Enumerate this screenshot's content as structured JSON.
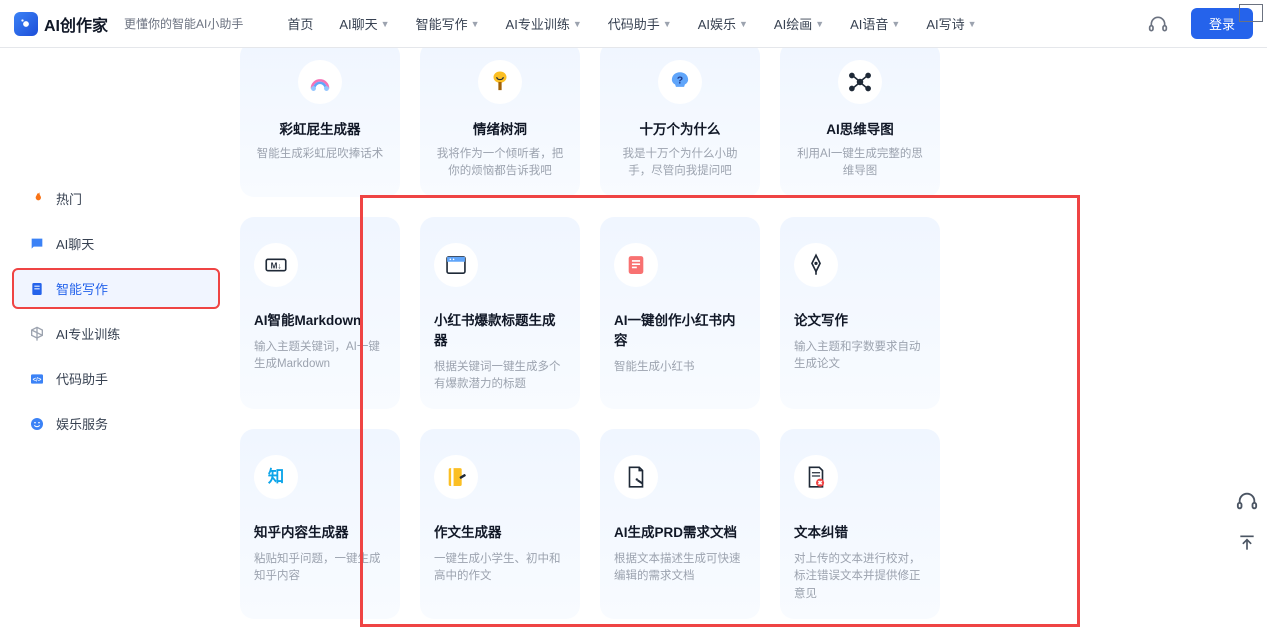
{
  "header": {
    "brand": "AI创作家",
    "slogan": "更懂你的智能AI小助手",
    "nav": [
      {
        "label": "首页",
        "dropdown": false
      },
      {
        "label": "AI聊天",
        "dropdown": true
      },
      {
        "label": "智能写作",
        "dropdown": true
      },
      {
        "label": "AI专业训练",
        "dropdown": true
      },
      {
        "label": "代码助手",
        "dropdown": true
      },
      {
        "label": "AI娱乐",
        "dropdown": true
      },
      {
        "label": "AI绘画",
        "dropdown": true
      },
      {
        "label": "AI语音",
        "dropdown": true
      },
      {
        "label": "AI写诗",
        "dropdown": true
      }
    ],
    "login": "登录"
  },
  "sidebar": {
    "items": [
      {
        "icon": "flame",
        "label": "热门",
        "color": "#f97316"
      },
      {
        "icon": "chat",
        "label": "AI聊天",
        "color": "#3b82f6"
      },
      {
        "icon": "doc",
        "label": "智能写作",
        "color": "#2563eb",
        "active": true
      },
      {
        "icon": "cube",
        "label": "AI专业训练",
        "color": "#9ca3af"
      },
      {
        "icon": "code",
        "label": "代码助手",
        "color": "#3b82f6"
      },
      {
        "icon": "smile",
        "label": "娱乐服务",
        "color": "#3b82f6"
      }
    ]
  },
  "tiles_top": [
    {
      "icon": "rainbow",
      "title": "彩虹屁生成器",
      "desc": "智能生成彩虹屁吹捧话术"
    },
    {
      "icon": "tree",
      "title": "情绪树洞",
      "desc": "我将作为一个倾听者，把你的烦恼都告诉我吧"
    },
    {
      "icon": "question",
      "title": "十万个为什么",
      "desc": "我是十万个为什么小助手，尽管向我提问吧"
    },
    {
      "icon": "mindmap",
      "title": "AI思维导图",
      "desc": "利用AI一键生成完整的思维导图"
    }
  ],
  "tiles_mid": [
    {
      "icon": "markdown",
      "title": "AI智能Markdown",
      "desc": "输入主题关键词，AI一键生成Markdown"
    },
    {
      "icon": "window",
      "title": "小红书爆款标题生成器",
      "desc": "根据关键词一键生成多个有爆款潜力的标题"
    },
    {
      "icon": "note",
      "title": "AI一键创作小红书内容",
      "desc": "智能生成小红书"
    },
    {
      "icon": "pen",
      "title": "论文写作",
      "desc": "输入主题和字数要求自动生成论文"
    }
  ],
  "tiles_bot": [
    {
      "icon": "zhi",
      "title": "知乎内容生成器",
      "desc": "粘贴知乎问题，一键生成知乎内容"
    },
    {
      "icon": "essay",
      "title": "作文生成器",
      "desc": "一键生成小学生、初中和高中的作文"
    },
    {
      "icon": "prd",
      "title": "AI生成PRD需求文档",
      "desc": "根据文本描述生成可快速编辑的需求文档"
    },
    {
      "icon": "correct",
      "title": "文本纠错",
      "desc": "对上传的文本进行校对，标注错误文本并提供修正意见"
    }
  ]
}
